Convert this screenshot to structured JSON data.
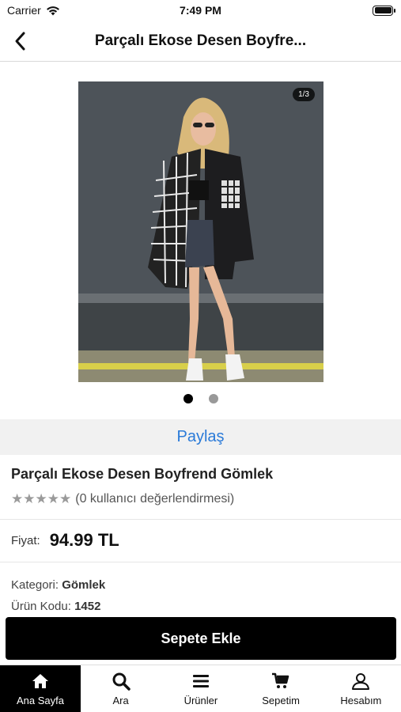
{
  "status_bar": {
    "carrier": "Carrier",
    "time": "7:49 PM"
  },
  "nav": {
    "title": "Parçalı Ekose Desen  Boyfre...",
    "back_icon": "chevron-left-icon"
  },
  "gallery": {
    "counter": "1/3",
    "active_index": 0,
    "dot_count": 2
  },
  "share": {
    "label": "Paylaş"
  },
  "product": {
    "name": "Parçalı Ekose Desen  Boyfrend Gömlek",
    "rating_text": "(0 kullanıcı değerlendirmesi)",
    "stars_filled": 0,
    "stars_total": 5,
    "price_label": "Fiyat:",
    "price": "94.99 TL",
    "category_label": "Kategori:",
    "category": "Gömlek",
    "code_label": "Ürün Kodu:",
    "code": "1452"
  },
  "actions": {
    "add_to_cart": "Sepete Ekle"
  },
  "tabs": [
    {
      "label": "Ana Sayfa",
      "icon": "home-icon",
      "active": true
    },
    {
      "label": "Ara",
      "icon": "search-icon",
      "active": false
    },
    {
      "label": "Ürünler",
      "icon": "menu-icon",
      "active": false
    },
    {
      "label": "Sepetim",
      "icon": "cart-icon",
      "active": false
    },
    {
      "label": "Hesabım",
      "icon": "user-icon",
      "active": false
    }
  ],
  "colors": {
    "accent_link": "#2a7ad8",
    "primary_button": "#000000",
    "share_bg": "#f1f1f1"
  }
}
